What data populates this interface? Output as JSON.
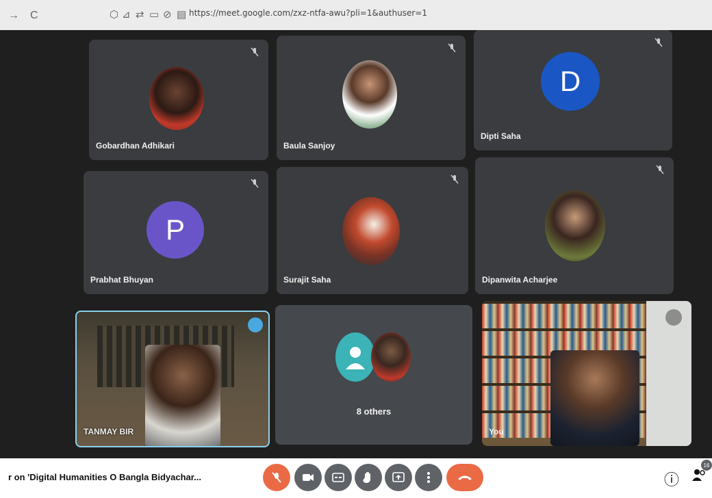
{
  "browser": {
    "back_icon": "→",
    "reload_icon": "C",
    "url": "https://meet.google.com/zxz-ntfa-awu?pli=1&authuser=1"
  },
  "participants": [
    {
      "name": "Gobardhan Adhikari",
      "type": "photo",
      "muted": true
    },
    {
      "name": "Baula Sanjoy",
      "type": "photo",
      "muted": true
    },
    {
      "name": "Dipti Saha",
      "type": "letter",
      "letter": "D",
      "color": "#1a57c4",
      "muted": true
    },
    {
      "name": "Prabhat Bhuyan",
      "type": "letter",
      "letter": "P",
      "color": "#6a55c8",
      "muted": true
    },
    {
      "name": "Surajit Saha",
      "type": "photo",
      "muted": true
    },
    {
      "name": "Dipanwita Acharjee",
      "type": "photo",
      "muted": true
    },
    {
      "name": "TANMAY BIR",
      "type": "video",
      "speaking": true
    },
    {
      "name": "8 others",
      "type": "group"
    },
    {
      "name": "You",
      "type": "video",
      "muted": true
    }
  ],
  "meeting": {
    "title": "r on 'Digital Humanities O Bangla Bidyachar...",
    "participant_count": "16"
  },
  "controls": {
    "mic": "mic-off-icon",
    "camera": "camera-icon",
    "captions": "captions-icon",
    "raise_hand": "hand-icon",
    "present": "present-icon",
    "more": "more-icon",
    "leave": "hangup-icon"
  },
  "colors": {
    "accent_red": "#ea6a45",
    "control_grey": "#5f6368",
    "tile_bg": "#3a3c3f",
    "speaking_border": "#8ad0f0"
  }
}
